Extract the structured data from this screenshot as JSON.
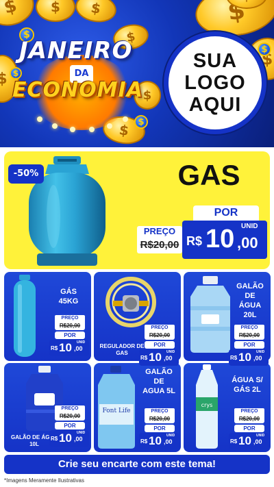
{
  "header": {
    "title_line1": "JANEIRO",
    "title_line2": "DA",
    "title_line3": "ECONOMIA",
    "logo_text": [
      "SUA",
      "LOGO",
      "AQUI"
    ]
  },
  "featured": {
    "discount": "-50%",
    "name": "GAS",
    "por_label": "POR",
    "preco_label": "PREÇO",
    "old_price": "R$20,00",
    "currency": "R$",
    "price_int": "10",
    "price_cents": ",00",
    "unit": "UNID"
  },
  "products": [
    {
      "name_lines": [
        "GÁS",
        "45KG"
      ],
      "caption": "",
      "preco_label": "PREÇO",
      "old_price": "R$20,00",
      "por_label": "POR",
      "currency": "R$",
      "price_int": "10",
      "price_cents": ",00",
      "unit": "UNID"
    },
    {
      "name_lines": [],
      "caption": "REGULADOR DE GAS",
      "preco_label": "PREÇO",
      "old_price": "R$20,00",
      "por_label": "POR",
      "currency": "R$",
      "price_int": "10",
      "price_cents": ",00",
      "unit": "UNID"
    },
    {
      "name_lines": [
        "GALÃO",
        "DE",
        "ÁGUA",
        "20L"
      ],
      "caption": "",
      "preco_label": "PREÇO",
      "old_price": "R$20,00",
      "por_label": "POR",
      "currency": "R$",
      "price_int": "10",
      "price_cents": ",00",
      "unit": "UNID"
    },
    {
      "name_lines": [],
      "caption": "GALÃO DE ÁGUA 10L",
      "preco_label": "PREÇO",
      "old_price": "R$20,00",
      "por_label": "POR",
      "currency": "R$",
      "price_int": "10",
      "price_cents": ",00",
      "unit": "UNID"
    },
    {
      "name_lines": [
        "GALÃO",
        "DE",
        "AGUA 5L"
      ],
      "caption": "",
      "preco_label": "PREÇO",
      "old_price": "R$20,00",
      "por_label": "POR",
      "currency": "R$",
      "price_int": "10",
      "price_cents": ",00",
      "unit": "UNID"
    },
    {
      "name_lines": [
        "ÁGUA S/",
        "GÁS 2L"
      ],
      "caption": "",
      "preco_label": "PREÇO",
      "old_price": "R$20,00",
      "por_label": "POR",
      "currency": "R$",
      "price_int": "10",
      "price_cents": ",00",
      "unit": "UNID"
    }
  ],
  "bottle_labels": {
    "font_life": "Font Life",
    "crystal": "crys"
  },
  "footer": {
    "cta": "Crie seu encarte com este tema!",
    "disclaimer": "*Imagens Meramente Ilustrativas"
  },
  "colors": {
    "brand_blue": "#1533c7",
    "yellow": "#fff23a",
    "gold": "#ffc928"
  }
}
